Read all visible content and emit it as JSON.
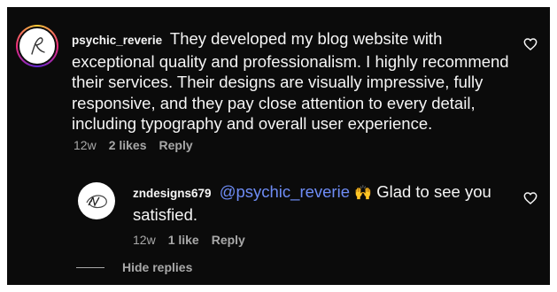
{
  "comment": {
    "username": "psychic_reverie",
    "text": "They developed my blog website with exceptional quality and professionalism. I highly recommend their services. Their designs are visually impressive, fully responsive, and they pay close attention to every detail, including typography and overall user experience.",
    "time": "12w",
    "likes": "2 likes",
    "reply_label": "Reply",
    "like_icon": "heart-outline-icon"
  },
  "reply": {
    "username": "zndesigns679",
    "mention": "@psychic_reverie",
    "emoji": "🙌",
    "text": "Glad to see you satisfied.",
    "time": "12w",
    "likes": "1 like",
    "reply_label": "Reply",
    "like_icon": "heart-outline-icon"
  },
  "thread": {
    "hide_replies_label": "Hide replies"
  },
  "colors": {
    "background": "#0b0b0b",
    "text": "#f5f5f5",
    "muted": "#a8a8a8",
    "mention": "#6e8cf5"
  }
}
